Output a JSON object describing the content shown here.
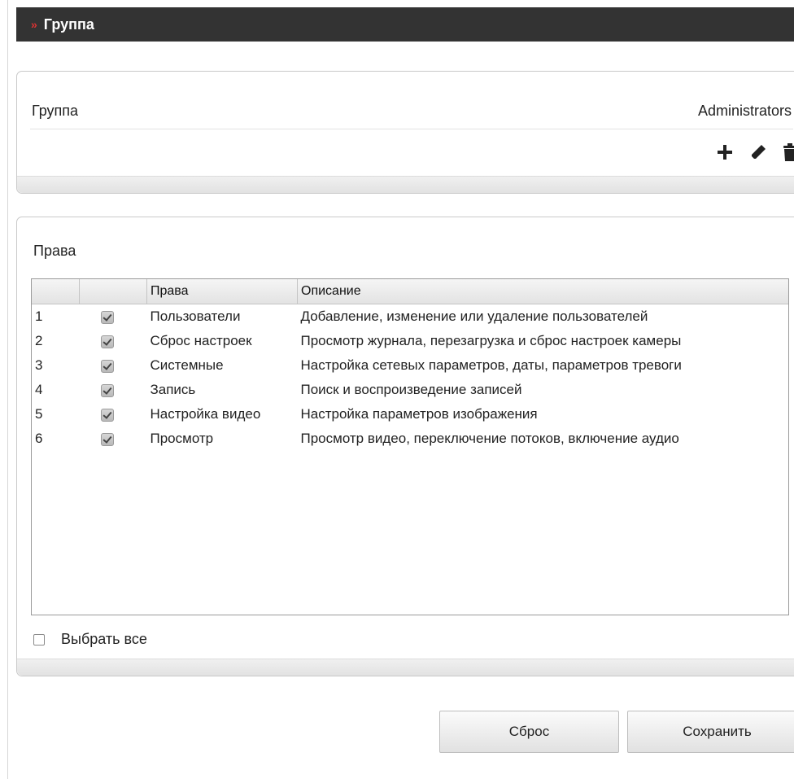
{
  "header": {
    "title": "Группа"
  },
  "group_section": {
    "label": "Группа",
    "selected_group": "Administrators"
  },
  "rights_section": {
    "title": "Права",
    "columns": [
      "",
      "",
      "Права",
      "Описание"
    ],
    "rows": [
      {
        "num": "1",
        "checked": true,
        "right": "Пользователи",
        "description": "Добавление, изменение или удаление пользователей"
      },
      {
        "num": "2",
        "checked": true,
        "right": "Сброс настроек",
        "description": "Просмотр журнала, перезагрузка и сброс настроек камеры"
      },
      {
        "num": "3",
        "checked": true,
        "right": "Системные",
        "description": "Настройка сетевых параметров, даты, параметров тревоги"
      },
      {
        "num": "4",
        "checked": true,
        "right": "Запись",
        "description": "Поиск и воспроизведение записей"
      },
      {
        "num": "5",
        "checked": true,
        "right": "Настройка видео",
        "description": "Настройка параметров изображения"
      },
      {
        "num": "6",
        "checked": true,
        "right": "Просмотр",
        "description": "Просмотр видео, переключение потоков, включение аудио"
      }
    ],
    "select_all_label": "Выбрать все"
  },
  "buttons": {
    "reset": "Сброс",
    "save": "Сохранить"
  },
  "icons": {
    "header": "double-chevron-right-icon",
    "add": "plus-icon",
    "edit": "pencil-icon",
    "delete": "trash-icon"
  },
  "colors": {
    "header_bg": "#333333",
    "accent": "#dd3333"
  }
}
